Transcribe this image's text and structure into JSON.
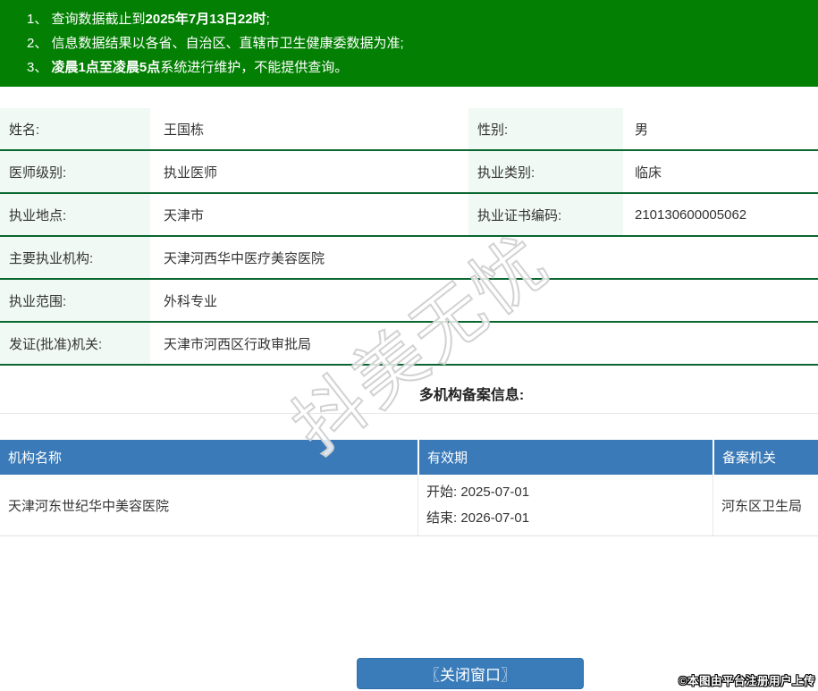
{
  "banner": {
    "lines": [
      {
        "pre": "1、 查询数据截止到",
        "bold": "2025年7月13日22时",
        "post": ";"
      },
      {
        "pre": "2、 信息数据结果以各省、自治区、直辖市卫生健康委数据为准;",
        "bold": "",
        "post": ""
      },
      {
        "pre": "3、 ",
        "bold": "凌晨1点至凌晨5点",
        "post": "系统进行维护，不能提供查询。"
      }
    ]
  },
  "info": {
    "rows": [
      {
        "cells": [
          {
            "label": "姓名:",
            "value": "王国栋"
          },
          {
            "label": "性别:",
            "value": "男"
          }
        ]
      },
      {
        "cells": [
          {
            "label": "医师级别:",
            "value": "执业医师"
          },
          {
            "label": "执业类别:",
            "value": "临床"
          }
        ]
      },
      {
        "cells": [
          {
            "label": "执业地点:",
            "value": "天津市"
          },
          {
            "label": "执业证书编码:",
            "value": "210130600005062"
          }
        ]
      },
      {
        "cells": [
          {
            "label": "主要执业机构:",
            "value": "天津河西华中医疗美容医院"
          }
        ]
      },
      {
        "cells": [
          {
            "label": "执业范围:",
            "value": "外科专业"
          }
        ]
      },
      {
        "cells": [
          {
            "label": "发证(批准)机关:",
            "value": "天津市河西区行政审批局"
          }
        ]
      }
    ]
  },
  "filing": {
    "title": "多机构备案信息:",
    "headers": [
      "机构名称",
      "有效期",
      "备案机关"
    ],
    "rows": [
      {
        "name": "天津河东世纪华中美容医院",
        "start": "开始: 2025-07-01",
        "end": "结束: 2026-07-01",
        "authority": "河东区卫生局"
      }
    ]
  },
  "button": {
    "label": "〖关闭窗口〗"
  },
  "watermark": {
    "text": "抖美无忧"
  },
  "attribution": {
    "text": "©本图由平台注册用户上传"
  },
  "colors": {
    "banner_green": "#038003",
    "row_divider_green": "#09662f",
    "label_cell_green": "#f0f9f3",
    "table_header_blue": "#3a7ab8",
    "button_blue": "#3a7cba"
  }
}
